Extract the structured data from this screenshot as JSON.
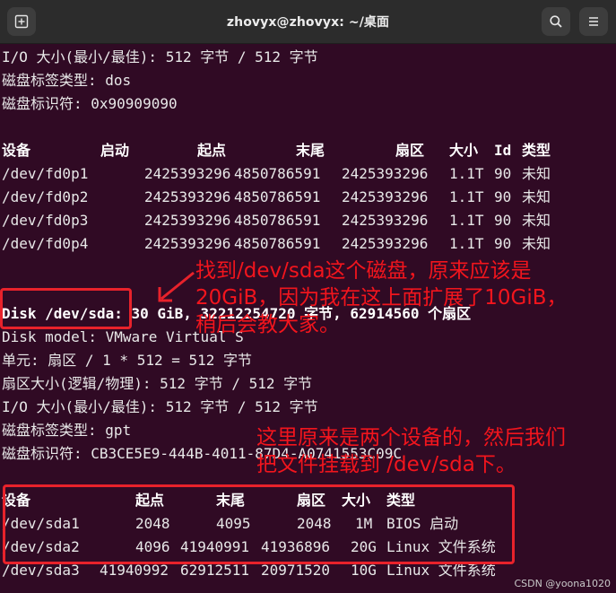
{
  "window": {
    "title": "zhovyx@zhovyx: ~/桌面",
    "new_tab_icon": "new-tab-icon",
    "search_icon": "search-icon",
    "menu_icon": "hamburger-menu-icon"
  },
  "terminal": {
    "top_lines": [
      "I/O 大小(最小/最佳): 512 字节 / 512 字节",
      "磁盘标签类型: dos",
      "磁盘标识符: 0x90909090"
    ],
    "fd_table": {
      "headers": [
        "设备",
        "启动",
        "起点",
        "末尾",
        "扇区",
        "大小",
        "Id",
        "类型"
      ],
      "rows": [
        [
          "/dev/fd0p1",
          "2425393296",
          "4850786591",
          "2425393296",
          "1.1T",
          "90",
          "未知"
        ],
        [
          "/dev/fd0p2",
          "2425393296",
          "4850786591",
          "2425393296",
          "1.1T",
          "90",
          "未知"
        ],
        [
          "/dev/fd0p3",
          "2425393296",
          "4850786591",
          "2425393296",
          "1.1T",
          "90",
          "未知"
        ],
        [
          "/dev/fd0p4",
          "2425393296",
          "4850786591",
          "2425393296",
          "1.1T",
          "90",
          "未知"
        ]
      ]
    },
    "disk_line_label": "Disk /dev/sda:",
    "disk_line_rest": " 30 GiB, 32212254720 字节, 62914560 个扇区",
    "mid_lines": [
      "Disk model: VMware Virtual S",
      "单元: 扇区 / 1 * 512 = 512 字节",
      "扇区大小(逻辑/物理): 512 字节 / 512 字节",
      "I/O 大小(最小/最佳): 512 字节 / 512 字节",
      "磁盘标签类型: gpt",
      "磁盘标识符: CB3CE5E9-444B-4011-87D4-A0741553C09C"
    ],
    "sda_table": {
      "headers": [
        "设备",
        "起点",
        "末尾",
        "扇区",
        "大小",
        "类型"
      ],
      "rows": [
        [
          "/dev/sda1",
          "2048",
          "4095",
          "2048",
          "1M",
          "BIOS 启动"
        ],
        [
          "/dev/sda2",
          "4096",
          "41940991",
          "41936896",
          "20G",
          "Linux 文件系统"
        ],
        [
          "/dev/sda3",
          "41940992",
          "62912511",
          "20971520",
          "10G",
          "Linux 文件系统"
        ]
      ]
    }
  },
  "annotations": {
    "note1": "找到/dev/sda这个磁盘，原来应该是\n20GiB，因为我在这上面扩展了10GiB，\n稍后会教大家。",
    "note2": "这里原来是两个设备的，然后我们\n把文件挂载到 /dev/sda下。",
    "watermark": "CSDN @yoona1020"
  },
  "colors": {
    "terminal_bg": "#300a24",
    "annotation_red": "#f2151d"
  }
}
